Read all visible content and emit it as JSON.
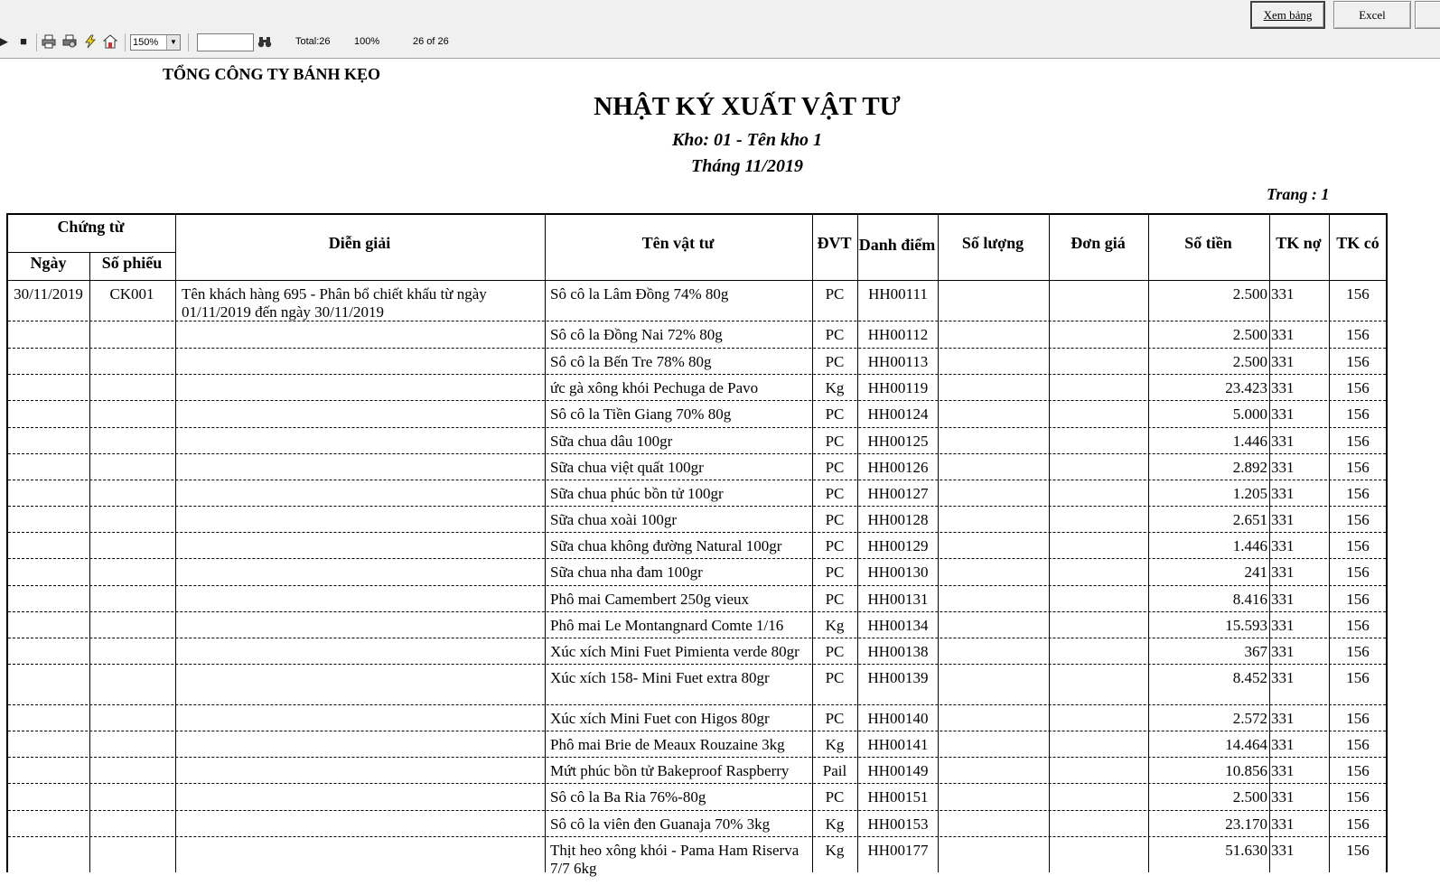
{
  "toolbar": {
    "zoom_select": "150%",
    "search_value": "",
    "total_label": "Total:26",
    "percent_label": "100%",
    "page_counter": "26 of 26",
    "view_button": "Xem bảng",
    "excel_button": "Excel"
  },
  "report": {
    "company": "TỔNG CÔNG TY BÁNH KẸO",
    "title": "NHẬT KÝ XUẤT VẬT TƯ",
    "warehouse": "Kho: 01 - Tên kho 1",
    "period": "Tháng 11/2019",
    "page_label": "Trang : 1"
  },
  "table": {
    "headers": {
      "voucher_group": "Chứng từ",
      "date": "Ngày",
      "voucher_no": "Số phiếu",
      "description": "Diễn giải",
      "item_name": "Tên vật tư",
      "unit": "ĐVT",
      "item_code": "Danh điểm",
      "quantity": "Số lượng",
      "unit_price": "Đơn giá",
      "amount": "Số tiền",
      "debit": "TK nợ",
      "credit": "TK có"
    },
    "rows": [
      {
        "date": "30/11/2019",
        "no": "CK001",
        "desc": "Tên khách hàng 695 - Phân bổ chiết khấu  từ ngày 01/11/2019 đến ngày 30/11/2019",
        "name": "Sô cô la Lâm Đồng 74% 80g",
        "unit": "PC",
        "code": "HH00111",
        "qty": "",
        "price": "",
        "amount": "2.500",
        "debit": "331",
        "credit": "156"
      },
      {
        "date": "",
        "no": "",
        "desc": "",
        "name": "Sô cô la Đồng Nai 72% 80g",
        "unit": "PC",
        "code": "HH00112",
        "qty": "",
        "price": "",
        "amount": "2.500",
        "debit": "331",
        "credit": "156"
      },
      {
        "date": "",
        "no": "",
        "desc": "",
        "name": "Sô cô la Bến Tre 78% 80g",
        "unit": "PC",
        "code": "HH00113",
        "qty": "",
        "price": "",
        "amount": "2.500",
        "debit": "331",
        "credit": "156"
      },
      {
        "date": "",
        "no": "",
        "desc": "",
        "name": "ức gà xông khói Pechuga de Pavo",
        "unit": "Kg",
        "code": "HH00119",
        "qty": "",
        "price": "",
        "amount": "23.423",
        "debit": "331",
        "credit": "156"
      },
      {
        "date": "",
        "no": "",
        "desc": "",
        "name": "Sô cô la Tiền Giang 70% 80g",
        "unit": "PC",
        "code": "HH00124",
        "qty": "",
        "price": "",
        "amount": "5.000",
        "debit": "331",
        "credit": "156"
      },
      {
        "date": "",
        "no": "",
        "desc": "",
        "name": "Sữa chua dâu 100gr",
        "unit": "PC",
        "code": "HH00125",
        "qty": "",
        "price": "",
        "amount": "1.446",
        "debit": "331",
        "credit": "156"
      },
      {
        "date": "",
        "no": "",
        "desc": "",
        "name": "Sữa chua việt quất 100gr",
        "unit": "PC",
        "code": "HH00126",
        "qty": "",
        "price": "",
        "amount": "2.892",
        "debit": "331",
        "credit": "156"
      },
      {
        "date": "",
        "no": "",
        "desc": "",
        "name": "Sữa chua phúc bồn tử 100gr",
        "unit": "PC",
        "code": "HH00127",
        "qty": "",
        "price": "",
        "amount": "1.205",
        "debit": "331",
        "credit": "156"
      },
      {
        "date": "",
        "no": "",
        "desc": "",
        "name": "Sữa chua xoài 100gr",
        "unit": "PC",
        "code": "HH00128",
        "qty": "",
        "price": "",
        "amount": "2.651",
        "debit": "331",
        "credit": "156"
      },
      {
        "date": "",
        "no": "",
        "desc": "",
        "name": "Sữa chua không đường Natural 100gr",
        "unit": "PC",
        "code": "HH00129",
        "qty": "",
        "price": "",
        "amount": "1.446",
        "debit": "331",
        "credit": "156"
      },
      {
        "date": "",
        "no": "",
        "desc": "",
        "name": "Sữa chua nha đam 100gr",
        "unit": "PC",
        "code": "HH00130",
        "qty": "",
        "price": "",
        "amount": "241",
        "debit": "331",
        "credit": "156"
      },
      {
        "date": "",
        "no": "",
        "desc": "",
        "name": "Phô mai Camembert 250g vieux",
        "unit": "PC",
        "code": "HH00131",
        "qty": "",
        "price": "",
        "amount": "8.416",
        "debit": "331",
        "credit": "156"
      },
      {
        "date": "",
        "no": "",
        "desc": "",
        "name": "Phô mai Le Montangnard Comte 1/16",
        "unit": "Kg",
        "code": "HH00134",
        "qty": "",
        "price": "",
        "amount": "15.593",
        "debit": "331",
        "credit": "156"
      },
      {
        "date": "",
        "no": "",
        "desc": "",
        "name": "Xúc xích Mini Fuet Pimienta verde 80gr",
        "unit": "PC",
        "code": "HH00138",
        "qty": "",
        "price": "",
        "amount": "367",
        "debit": "331",
        "credit": "156"
      },
      {
        "date": "",
        "no": "",
        "desc": "",
        "name": "Xúc xích 158- Mini Fuet extra 80gr",
        "unit": "PC",
        "code": "HH00139",
        "qty": "",
        "price": "",
        "amount": "8.452",
        "debit": "331",
        "credit": "156"
      },
      {
        "date": "",
        "no": "",
        "desc": "",
        "name": "Xúc xích Mini Fuet con Higos 80gr",
        "unit": "PC",
        "code": "HH00140",
        "qty": "",
        "price": "",
        "amount": "2.572",
        "debit": "331",
        "credit": "156"
      },
      {
        "date": "",
        "no": "",
        "desc": "",
        "name": "Phô mai Brie de Meaux Rouzaine 3kg",
        "unit": "Kg",
        "code": "HH00141",
        "qty": "",
        "price": "",
        "amount": "14.464",
        "debit": "331",
        "credit": "156"
      },
      {
        "date": "",
        "no": "",
        "desc": "",
        "name": "Mứt phúc bồn tử Bakeproof Raspberry",
        "unit": "Pail",
        "code": "HH00149",
        "qty": "",
        "price": "",
        "amount": "10.856",
        "debit": "331",
        "credit": "156"
      },
      {
        "date": "",
        "no": "",
        "desc": "",
        "name": "Sô cô la Ba Ria 76%-80g",
        "unit": "PC",
        "code": "HH00151",
        "qty": "",
        "price": "",
        "amount": "2.500",
        "debit": "331",
        "credit": "156"
      },
      {
        "date": "",
        "no": "",
        "desc": "",
        "name": "Sô cô la viên đen Guanaja 70% 3kg",
        "unit": "Kg",
        "code": "HH00153",
        "qty": "",
        "price": "",
        "amount": "23.170",
        "debit": "331",
        "credit": "156"
      },
      {
        "date": "",
        "no": "",
        "desc": "",
        "name": "Thịt heo xông khói - Pama Ham Riserva 7/7 6kg",
        "unit": "Kg",
        "code": "HH00177",
        "qty": "",
        "price": "",
        "amount": "51.630",
        "debit": "331",
        "credit": "156"
      }
    ]
  }
}
